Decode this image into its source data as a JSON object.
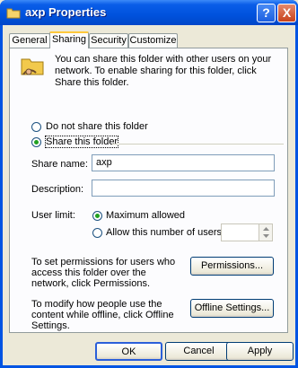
{
  "window": {
    "title": "axp Properties",
    "help_label": "?",
    "close_label": "X"
  },
  "tabs": [
    {
      "label": "General"
    },
    {
      "label": "Sharing"
    },
    {
      "label": "Security"
    },
    {
      "label": "Customize"
    }
  ],
  "sharing": {
    "intro": "You can share this folder with other users on your network.  To enable sharing for this folder, click Share this folder.",
    "do_not_share_label": "Do not share this folder",
    "share_label": "Share this folder",
    "share_name_label": "Share name:",
    "share_name_value": "axp",
    "description_label": "Description:",
    "description_value": "",
    "user_limit_label": "User limit:",
    "max_allowed_label": "Maximum allowed",
    "allow_users_label": "Allow this number of users:",
    "user_count_value": "",
    "permissions_text": "To set permissions for users who access this folder over the network, click Permissions.",
    "permissions_button": "Permissions...",
    "offline_text": "To modify how people use the content while offline, click Offline Settings.",
    "offline_button": "Offline Settings..."
  },
  "buttons": {
    "ok": "OK",
    "cancel": "Cancel",
    "apply": "Apply"
  }
}
